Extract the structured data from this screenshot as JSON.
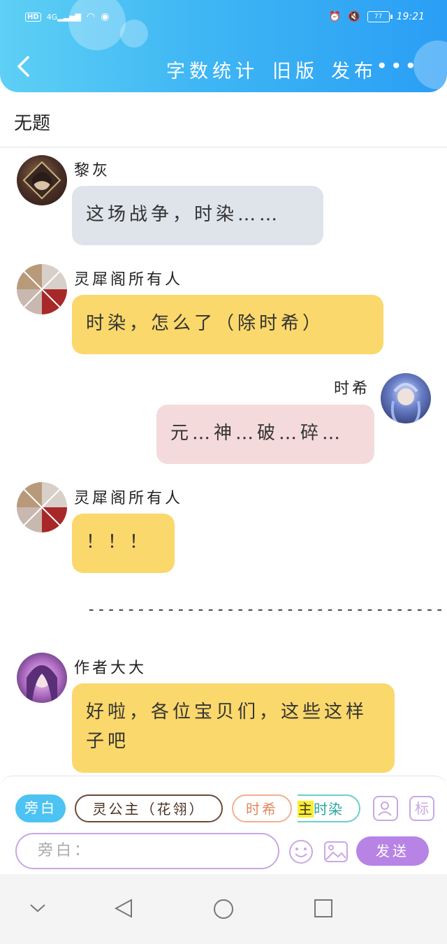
{
  "status": {
    "time": "19:21",
    "battery": "77",
    "network": "4G"
  },
  "header": {
    "word_count": "字数统计",
    "old_version": "旧版",
    "publish": "发布",
    "more": "•••"
  },
  "title": "无题",
  "messages": [
    {
      "name": "黎灰",
      "text": "这场战争，时染……",
      "side": "left",
      "color": "#dfe3ea"
    },
    {
      "name": "灵犀阁所有人",
      "text": "时染，怎么了（除时希）",
      "side": "left",
      "color": "#fbd86b"
    },
    {
      "name": "时希",
      "text": "元…神…破…碎…",
      "side": "right",
      "color": "#f5dadb"
    },
    {
      "name": "灵犀阁所有人",
      "text": "！！！",
      "side": "left",
      "color": "#fbd86b"
    },
    {
      "name": "作者大大",
      "text": "好啦，各位宝贝们，这些这样子吧",
      "side": "left",
      "color": "#fbd86b"
    }
  ],
  "divider": "------------------------------------",
  "composer": {
    "chips": [
      "旁白",
      "灵公主（花翎）",
      "时希",
      "主",
      "时染"
    ],
    "placeholder": "旁白：",
    "tag_label": "标",
    "send_label": "发送"
  }
}
